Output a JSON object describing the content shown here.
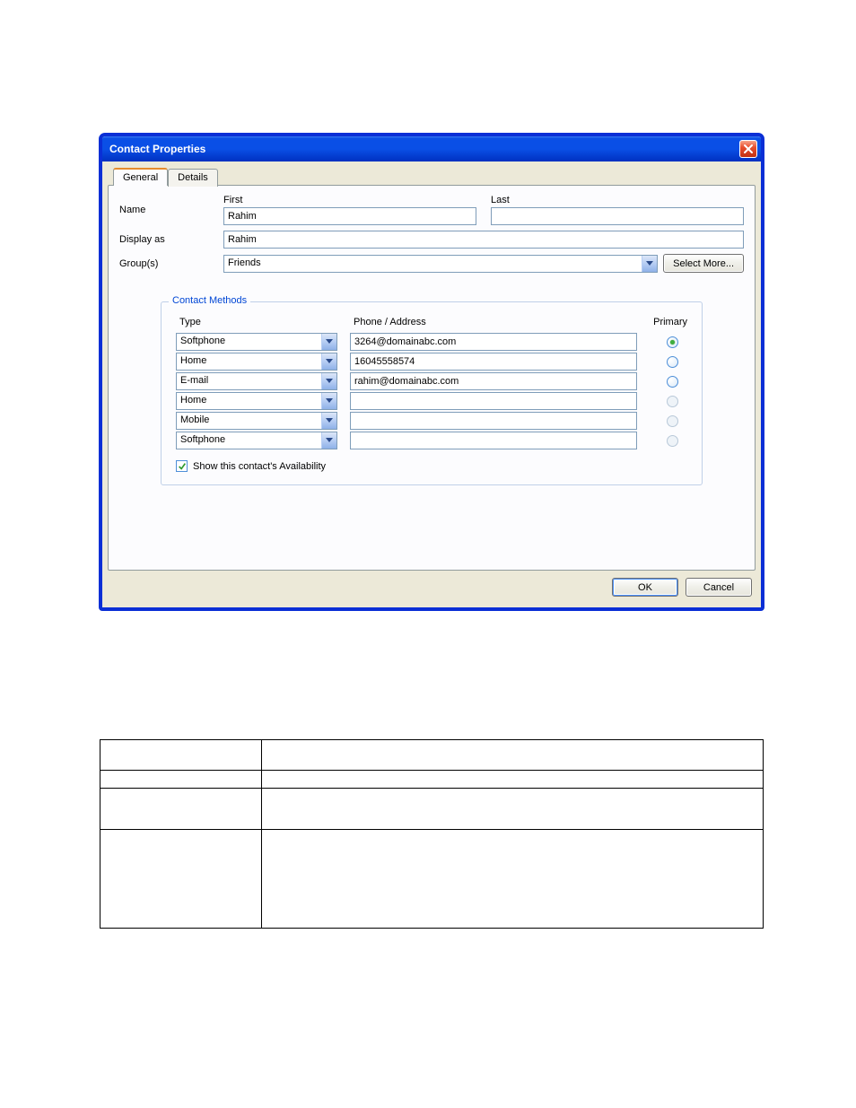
{
  "titlebar": {
    "title": "Contact Properties"
  },
  "tabs": {
    "general": "General",
    "details": "Details"
  },
  "labels": {
    "name": "Name",
    "first": "First",
    "last": "Last",
    "display_as": "Display as",
    "groups": "Group(s)",
    "select_more": "Select More...",
    "contact_methods": "Contact Methods",
    "type": "Type",
    "phone_address": "Phone / Address",
    "primary": "Primary",
    "show_availability": "Show this contact's Availability"
  },
  "fields": {
    "first": "Rahim",
    "last": "",
    "display_as": "Rahim",
    "groups": "Friends",
    "show_availability_checked": true
  },
  "contact_methods": [
    {
      "type": "Softphone",
      "value": "3264@domainabc.com",
      "primary": true,
      "enabled": true
    },
    {
      "type": "Home",
      "value": "16045558574",
      "primary": false,
      "enabled": true
    },
    {
      "type": "E-mail",
      "value": "rahim@domainabc.com",
      "primary": false,
      "enabled": true
    },
    {
      "type": "Home",
      "value": "",
      "primary": false,
      "enabled": false
    },
    {
      "type": "Mobile",
      "value": "",
      "primary": false,
      "enabled": false
    },
    {
      "type": "Softphone",
      "value": "",
      "primary": false,
      "enabled": false
    }
  ],
  "buttons": {
    "ok": "OK",
    "cancel": "Cancel"
  }
}
